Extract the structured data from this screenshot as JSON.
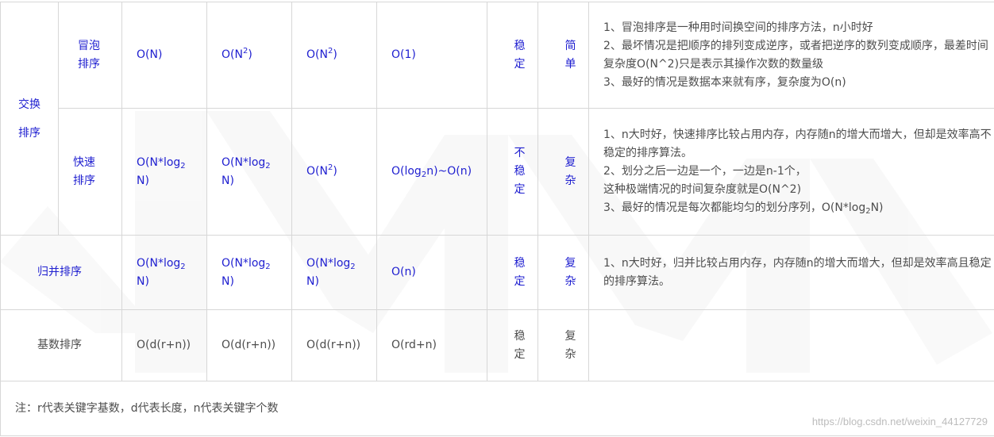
{
  "groups": {
    "exchange": "交换\n排序"
  },
  "rows": {
    "bubble": {
      "name": "冒泡\n排序",
      "avg": "O(N)",
      "worst_base": "O(N",
      "worst_sup": "2",
      "worst_tail": ")",
      "best_base": "O(N",
      "best_sup": "2",
      "best_tail": ")",
      "space": "O(1)",
      "stability": "稳定",
      "complexity": "简单",
      "notes": [
        "1、冒泡排序是一种用时间换空间的排序方法，n小时好",
        "2、最坏情况是把顺序的排列变成逆序，或者把逆序的数列变成顺序，最差时间复杂度O(N^2)只是表示其操作次数的数量级",
        "3、最好的情况是数据本来就有序，复杂度为O(n)"
      ]
    },
    "quick": {
      "name": "快速\n排序",
      "avg_base": "O(N*log",
      "avg_sub": "2",
      "avg_tail": "N)",
      "worst_base": "O(N*log",
      "worst_sub": "2",
      "worst_tail": "N)",
      "best_base": "O(N",
      "best_sup": "2",
      "best_tail": ")",
      "space_base": "O(log",
      "space_sub": "2",
      "space_tail": "n)~O(n)",
      "stability": "不稳定",
      "complexity": "复杂",
      "notes": [
        "1、n大时好，快速排序比较占用内存，内存随n的增大而增大，但却是效率高不稳定的排序算法。",
        "2、划分之后一边是一个，一边是n-1个，",
        "这种极端情况的时间复杂度就是O(N^2)"
      ],
      "note_last_base": "3、最好的情况是每次都能均匀的划分序列，O(N*log",
      "note_last_sub": "2",
      "note_last_tail": "N)"
    },
    "merge": {
      "name": "归并排序",
      "col_base": "O(N*log",
      "col_sub": "2",
      "col_tail": "N)",
      "space": "O(n)",
      "stability": "稳定",
      "complexity": "复杂",
      "notes": [
        "1、n大时好，归并比较占用内存，内存随n的增大而增大，但却是效率高且稳定的排序算法。"
      ]
    },
    "radix": {
      "name": "基数排序",
      "avg": "O(d(r+n))",
      "worst": "O(d(r+n))",
      "best": "O(d(r+n))",
      "space": "O(rd+n)",
      "stability": "稳定",
      "complexity": "复杂"
    }
  },
  "footer": {
    "note": "注：r代表关键字基数，d代表长度，n代表关键字个数"
  },
  "watermark": {
    "url": "https://blog.csdn.net/weixin_44127729"
  }
}
